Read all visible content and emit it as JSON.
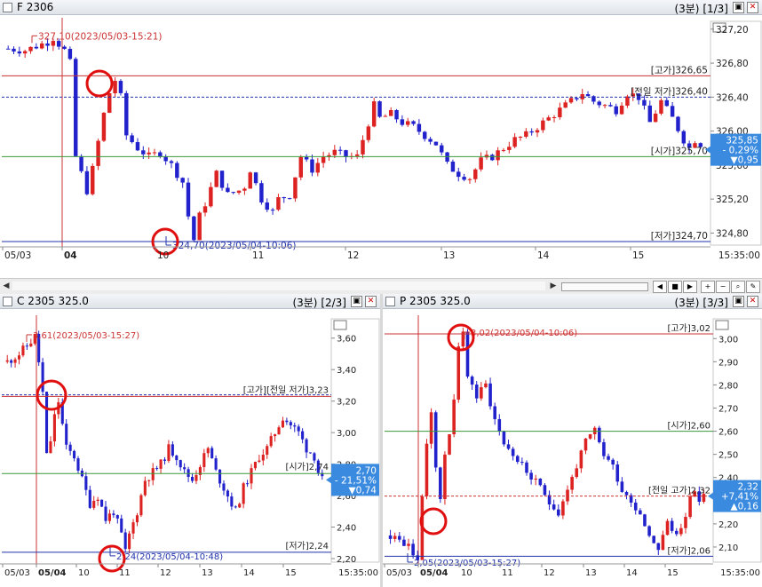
{
  "colors": {
    "up": "#dd2222",
    "down": "#2222cc",
    "accent_label": "#3a8be0",
    "hi_line": "#cc3333",
    "open_line": "#3a9a3a",
    "prev_line": "#2233aa"
  },
  "main": {
    "title": "F 2306",
    "period": "(3분)",
    "page": "[1/3]",
    "last_box": [
      "325,85",
      "- 0,29%",
      "▼0,95"
    ],
    "annotations": {
      "high": "[고가]326,65",
      "prev_low": "[전일 저가]326,40",
      "open": "[시가]325,70",
      "low": "[저가]324,70",
      "max_marker": "327,10(2023/05/03-15:21)",
      "min_marker": "324,70(2023/05/04-10:06)"
    },
    "xaxis": {
      "ticks": [
        "05/03",
        "04",
        "10",
        "11",
        "12",
        "13",
        "14",
        "15"
      ],
      "end": "15:35:00"
    }
  },
  "call": {
    "title": "C 2305 325.0",
    "period": "(3분)",
    "page": "[2/3]",
    "last_box": [
      "2,70",
      "- 21,51%",
      "▼0,74"
    ],
    "annotations": {
      "high_prev": "[고가][전일 저가]3,23",
      "open": "[시가]2,74",
      "low": "[저가]2,24",
      "max_marker": "3,61(2023/05/03-15:27)",
      "min_marker": "2,24(2023/05/04-10:48)"
    },
    "xaxis": {
      "ticks": [
        "05/03",
        "05/04",
        "10",
        "11",
        "12",
        "13",
        "14",
        "15"
      ],
      "end": "15:35:00"
    }
  },
  "put": {
    "title": "P 2305 325.0",
    "period": "(3분)",
    "page": "[3/3]",
    "last_box": [
      "2,32",
      "+7,41%",
      "▲0,16"
    ],
    "annotations": {
      "high": "[고가]3,02",
      "open": "[시가]2,60",
      "prev_high": "[전일 고가]2,32",
      "low": "[저가]2,06",
      "max_marker": "3,02(2023/05/04-10:06)",
      "min_marker": "2,05(2023/05/03-15:27)"
    },
    "xaxis": {
      "ticks": [
        "05/03",
        "05/04",
        "10",
        "11",
        "12",
        "13",
        "14",
        "15"
      ],
      "end": "15:35:00"
    }
  },
  "chart_data": [
    {
      "type": "candlestick",
      "title": "F 2306",
      "y_ticks": [
        "327,20",
        "326,80",
        "326,40",
        "326,00",
        "325,60",
        "325,20",
        "324,80"
      ],
      "ylim": [
        324.7,
        327.25
      ],
      "levels": {
        "high": 326.65,
        "prev_low": 326.4,
        "open": 325.7,
        "low": 324.7
      },
      "path": [
        [
          0,
          326.97
        ],
        [
          3,
          326.95
        ],
        [
          5,
          327.0
        ],
        [
          7,
          327.05
        ],
        [
          8,
          327.1
        ],
        [
          10,
          326.95
        ],
        [
          11,
          326.8
        ],
        [
          12,
          325.7
        ],
        [
          14,
          325.3
        ],
        [
          15,
          325.55
        ],
        [
          17,
          326.2
        ],
        [
          18,
          326.45
        ],
        [
          19,
          326.6
        ],
        [
          20,
          326.4
        ],
        [
          21,
          325.95
        ],
        [
          23,
          325.8
        ],
        [
          25,
          325.7
        ],
        [
          27,
          325.75
        ],
        [
          29,
          325.6
        ],
        [
          31,
          325.4
        ],
        [
          32,
          325.0
        ],
        [
          33,
          324.72
        ],
        [
          34,
          325.0
        ],
        [
          35,
          325.15
        ],
        [
          37,
          325.5
        ],
        [
          39,
          325.25
        ],
        [
          41,
          325.3
        ],
        [
          42,
          325.35
        ],
        [
          43,
          325.55
        ],
        [
          45,
          325.2
        ],
        [
          47,
          325.05
        ],
        [
          48,
          325.2
        ],
        [
          50,
          325.25
        ],
        [
          52,
          325.7
        ],
        [
          54,
          325.55
        ],
        [
          56,
          325.7
        ],
        [
          58,
          325.75
        ],
        [
          60,
          325.7
        ],
        [
          62,
          325.7
        ],
        [
          64,
          326.1
        ],
        [
          65,
          326.3
        ],
        [
          66,
          326.15
        ],
        [
          68,
          326.2
        ],
        [
          70,
          326.1
        ],
        [
          72,
          326.05
        ],
        [
          74,
          325.95
        ],
        [
          76,
          325.85
        ],
        [
          78,
          325.6
        ],
        [
          80,
          325.5
        ],
        [
          82,
          325.45
        ],
        [
          84,
          325.65
        ],
        [
          86,
          325.7
        ],
        [
          88,
          325.8
        ],
        [
          90,
          325.9
        ],
        [
          92,
          325.95
        ],
        [
          94,
          326.05
        ],
        [
          96,
          326.15
        ],
        [
          98,
          326.25
        ],
        [
          100,
          326.35
        ],
        [
          102,
          326.45
        ],
        [
          104,
          326.35
        ],
        [
          106,
          326.3
        ],
        [
          108,
          326.25
        ],
        [
          110,
          326.45
        ],
        [
          112,
          326.4
        ],
        [
          114,
          326.1
        ],
        [
          116,
          326.35
        ],
        [
          118,
          326.15
        ],
        [
          120,
          325.9
        ],
        [
          121,
          325.8
        ],
        [
          122,
          325.9
        ],
        [
          123,
          325.85
        ]
      ]
    },
    {
      "type": "candlestick",
      "title": "C 2305 325.0",
      "y_ticks": [
        "3,60",
        "3,40",
        "3,20",
        "3,00",
        "2,80",
        "2,60",
        "2,40",
        "2,20"
      ],
      "ylim": [
        2.2,
        3.7
      ],
      "levels": {
        "high_prev_low": 3.23,
        "open": 2.74,
        "low": 2.24
      },
      "path": [
        [
          0,
          3.45
        ],
        [
          3,
          3.5
        ],
        [
          5,
          3.55
        ],
        [
          7,
          3.61
        ],
        [
          8,
          3.45
        ],
        [
          9,
          3.25
        ],
        [
          10,
          2.85
        ],
        [
          11,
          2.95
        ],
        [
          12,
          3.1
        ],
        [
          13,
          3.2
        ],
        [
          14,
          3.05
        ],
        [
          15,
          2.9
        ],
        [
          17,
          2.85
        ],
        [
          19,
          2.7
        ],
        [
          21,
          2.55
        ],
        [
          23,
          2.6
        ],
        [
          25,
          2.45
        ],
        [
          27,
          2.5
        ],
        [
          29,
          2.35
        ],
        [
          30,
          2.24
        ],
        [
          31,
          2.35
        ],
        [
          33,
          2.5
        ],
        [
          35,
          2.7
        ],
        [
          37,
          2.75
        ],
        [
          39,
          2.8
        ],
        [
          41,
          2.9
        ],
        [
          43,
          2.85
        ],
        [
          45,
          2.75
        ],
        [
          47,
          2.7
        ],
        [
          49,
          2.8
        ],
        [
          51,
          2.9
        ],
        [
          53,
          2.75
        ],
        [
          55,
          2.65
        ],
        [
          57,
          2.55
        ],
        [
          58,
          2.5
        ],
        [
          60,
          2.65
        ],
        [
          62,
          2.75
        ],
        [
          64,
          2.85
        ],
        [
          66,
          2.9
        ],
        [
          68,
          3.0
        ],
        [
          70,
          3.1
        ],
        [
          72,
          3.05
        ],
        [
          74,
          3.0
        ],
        [
          76,
          2.9
        ],
        [
          78,
          2.85
        ],
        [
          79,
          2.75
        ],
        [
          80,
          2.7
        ]
      ]
    },
    {
      "type": "candlestick",
      "title": "P 2305 325.0",
      "y_ticks": [
        "3,00",
        "2,90",
        "2,80",
        "2,70",
        "2,60",
        "2,50",
        "2,40",
        "2,30",
        "2,20",
        "2,10"
      ],
      "ylim": [
        2.05,
        3.07
      ],
      "levels": {
        "high": 3.02,
        "open": 2.6,
        "prev_high": 2.32,
        "low": 2.06
      },
      "path": [
        [
          0,
          2.15
        ],
        [
          3,
          2.12
        ],
        [
          5,
          2.08
        ],
        [
          6,
          2.05
        ],
        [
          7,
          2.3
        ],
        [
          8,
          2.55
        ],
        [
          9,
          2.7
        ],
        [
          10,
          2.45
        ],
        [
          11,
          2.3
        ],
        [
          12,
          2.5
        ],
        [
          13,
          2.6
        ],
        [
          14,
          2.75
        ],
        [
          15,
          2.95
        ],
        [
          16,
          3.02
        ],
        [
          17,
          2.85
        ],
        [
          19,
          2.75
        ],
        [
          21,
          2.8
        ],
        [
          23,
          2.65
        ],
        [
          25,
          2.55
        ],
        [
          27,
          2.5
        ],
        [
          29,
          2.45
        ],
        [
          31,
          2.4
        ],
        [
          33,
          2.35
        ],
        [
          35,
          2.3
        ],
        [
          37,
          2.25
        ],
        [
          39,
          2.35
        ],
        [
          41,
          2.45
        ],
        [
          43,
          2.55
        ],
        [
          45,
          2.6
        ],
        [
          47,
          2.5
        ],
        [
          49,
          2.45
        ],
        [
          51,
          2.35
        ],
        [
          53,
          2.3
        ],
        [
          55,
          2.25
        ],
        [
          57,
          2.15
        ],
        [
          59,
          2.1
        ],
        [
          61,
          2.2
        ],
        [
          63,
          2.15
        ],
        [
          65,
          2.25
        ],
        [
          67,
          2.35
        ],
        [
          68,
          2.3
        ],
        [
          69,
          2.32
        ]
      ]
    }
  ]
}
